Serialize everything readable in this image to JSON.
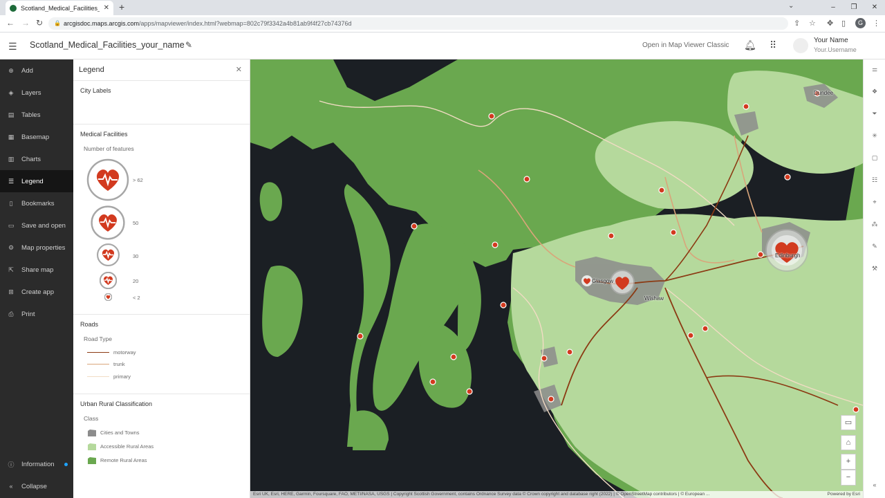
{
  "browser": {
    "tab_title": "Scotland_Medical_Facilities_your",
    "url_host": "arcgisdoc.maps.arcgis.com",
    "url_path": "/apps/mapviewer/index.html?webmap=802c79f3342a4b81ab9f4f27cb74376d",
    "profile_initial": "G"
  },
  "header": {
    "map_title": "Scotland_Medical_Facilities_your_name",
    "open_classic": "Open in Map Viewer Classic",
    "user_name": "Your Name",
    "user_login": "Your.Username"
  },
  "nav": {
    "items": [
      {
        "label": "Add",
        "icon": "plus-circle-icon"
      },
      {
        "label": "Layers",
        "icon": "layers-icon"
      },
      {
        "label": "Tables",
        "icon": "table-icon"
      },
      {
        "label": "Basemap",
        "icon": "basemap-icon"
      },
      {
        "label": "Charts",
        "icon": "chart-icon"
      },
      {
        "label": "Legend",
        "icon": "legend-icon"
      },
      {
        "label": "Bookmarks",
        "icon": "bookmark-icon"
      },
      {
        "label": "Save and open",
        "icon": "save-icon"
      },
      {
        "label": "Map properties",
        "icon": "gear-icon"
      },
      {
        "label": "Share map",
        "icon": "share-icon"
      },
      {
        "label": "Create app",
        "icon": "apps-icon"
      },
      {
        "label": "Print",
        "icon": "print-icon"
      }
    ],
    "active": "Legend",
    "information": "Information",
    "collapse": "Collapse"
  },
  "legend": {
    "title": "Legend",
    "city_labels": "City Labels",
    "medical": {
      "title": "Medical Facilities",
      "subtitle": "Number of features",
      "classes": [
        "> 62",
        "50",
        "30",
        "20",
        "< 2"
      ]
    },
    "roads": {
      "title": "Roads",
      "subtitle": "Road Type",
      "types": [
        {
          "label": "motorway",
          "color": "#8b3a13"
        },
        {
          "label": "trunk",
          "color": "#d9a57a"
        },
        {
          "label": "primary",
          "color": "#f2dcc4"
        }
      ]
    },
    "urban": {
      "title": "Urban Rural Classification",
      "subtitle": "Class",
      "classes": [
        {
          "label": "Cities and Towns",
          "color": "#8c8c8c"
        },
        {
          "label": "Accessible Rural Areas",
          "color": "#b5d99c"
        },
        {
          "label": "Remote Rural Areas",
          "color": "#6aa84f"
        }
      ]
    }
  },
  "map": {
    "cities": [
      "Dundee",
      "Glasgow",
      "Wishaw",
      "Edinburgh"
    ],
    "attribution": "Esri UK, Esri, HERE, Garmin, Foursquare, FAO, METI/NASA, USGS | Copyright Scottish Government, contains Ordnance Survey data © Crown copyright and database right (2022) | © OpenStreetMap contributors | © European ...",
    "powered_by": "Powered by Esri"
  }
}
